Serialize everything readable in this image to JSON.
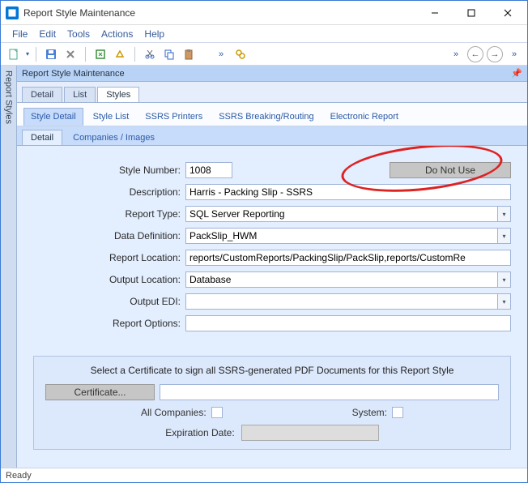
{
  "window": {
    "title": "Report Style Maintenance"
  },
  "menubar": {
    "file": "File",
    "edit": "Edit",
    "tools": "Tools",
    "actions": "Actions",
    "help": "Help"
  },
  "panel": {
    "header": "Report Style Maintenance",
    "pin": "📌"
  },
  "sidetab": {
    "label": "Report Styles"
  },
  "tabs1": {
    "detail": "Detail",
    "list": "List",
    "styles": "Styles"
  },
  "tabs2": {
    "style_detail": "Style Detail",
    "style_list": "Style List",
    "ssrs_printers": "SSRS Printers",
    "ssrs_breaking": "SSRS Breaking/Routing",
    "electronic_report": "Electronic Report"
  },
  "tabs3": {
    "detail": "Detail",
    "companies_images": "Companies / Images"
  },
  "form": {
    "style_number_label": "Style Number:",
    "style_number_value": "1008",
    "do_not_use": "Do Not Use",
    "description_label": "Description:",
    "description_value": "Harris - Packing Slip - SSRS",
    "report_type_label": "Report Type:",
    "report_type_value": "SQL Server Reporting",
    "data_definition_label": "Data Definition:",
    "data_definition_value": "PackSlip_HWM",
    "report_location_label": "Report Location:",
    "report_location_value": "reports/CustomReports/PackingSlip/PackSlip,reports/CustomRe",
    "output_location_label": "Output Location:",
    "output_location_value": "Database",
    "output_edi_label": "Output EDI:",
    "output_edi_value": "",
    "report_options_label": "Report Options:",
    "report_options_value": ""
  },
  "cert": {
    "title": "Select a Certificate to sign all SSRS-generated PDF Documents for this Report Style",
    "button": "Certificate...",
    "value": "",
    "all_companies_label": "All Companies:",
    "system_label": "System:",
    "expiration_label": "Expiration Date:"
  },
  "status": {
    "ready": "Ready"
  }
}
